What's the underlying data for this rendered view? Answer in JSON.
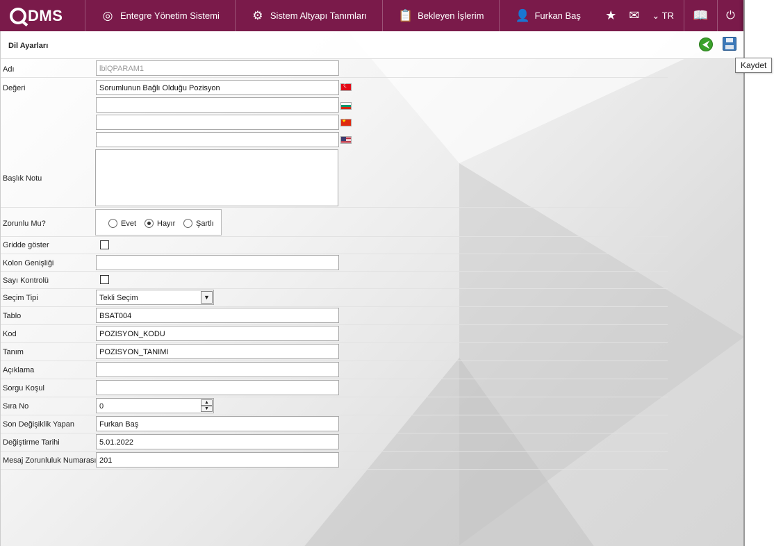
{
  "app": {
    "logo": "DMS",
    "nav": [
      {
        "label": "Entegre Yönetim Sistemi",
        "icon": "q-logo-icon"
      },
      {
        "label": "Sistem Altyapı Tanımları",
        "icon": "gear-icon"
      },
      {
        "label": "Bekleyen İşlerim",
        "icon": "clipboard-icon"
      },
      {
        "label": "Furkan Baş",
        "icon": "user-icon"
      }
    ],
    "lang": "TR"
  },
  "page": {
    "title": "Dil Ayarları",
    "tooltip": "Kaydet"
  },
  "form": {
    "adi_label": "Adı",
    "adi_value": "lblQPARAM1",
    "degeri_label": "Değeri",
    "degeri_tr": "Sorumlunun Bağlı Olduğu Pozisyon",
    "degeri_bg": "",
    "degeri_cn": "",
    "degeri_us": "",
    "baslik_label": "Başlık Notu",
    "zorunlu_label": "Zorunlu Mu?",
    "zorunlu_options": [
      "Evet",
      "Hayır",
      "Şartlı"
    ],
    "zorunlu_selected": "Hayır",
    "gridde_label": "Gridde göster",
    "kolon_label": "Kolon Genişliği",
    "kolon_value": "",
    "sayi_label": "Sayı Kontrolü",
    "secim_label": "Seçim Tipi",
    "secim_value": "Tekli Seçim",
    "tablo_label": "Tablo",
    "tablo_value": "BSAT004",
    "kod_label": "Kod",
    "kod_value": "POZISYON_KODU",
    "tanim_label": "Tanım",
    "tanim_value": "POZISYON_TANIMI",
    "aciklama_label": "Açıklama",
    "aciklama_value": "",
    "sorgu_label": "Sorgu Koşul",
    "sorgu_value": "",
    "sira_label": "Sıra No",
    "sira_value": "0",
    "son_label": "Son Değişiklik Yapan",
    "son_value": "Furkan Baş",
    "tarih_label": "Değiştirme Tarihi",
    "tarih_value": "5.01.2022",
    "mesaj_label": "Mesaj Zorunluluk Numarası",
    "mesaj_value": "201"
  }
}
